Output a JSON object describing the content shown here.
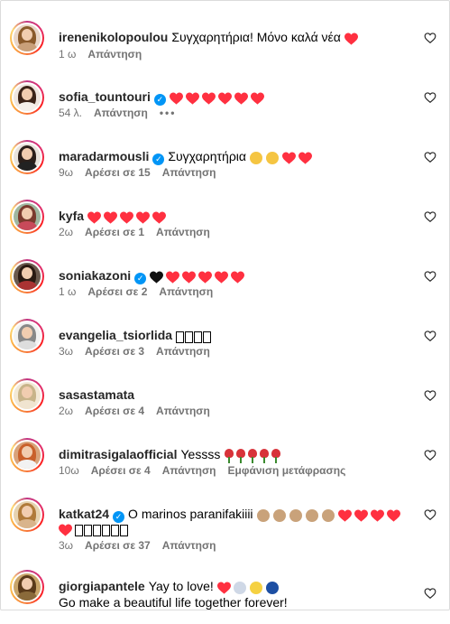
{
  "comments": [
    {
      "username": "irenenikolopoulou",
      "verified": false,
      "text": "Συγχαρητήρια! Μόνο καλά νέα",
      "time": "1 ω",
      "likes": "",
      "reply": "Απάντηση"
    },
    {
      "username": "sofia_tountouri",
      "verified": true,
      "text": "",
      "time": "54 λ.",
      "likes": "",
      "reply": "Απάντηση"
    },
    {
      "username": "maradarmousli",
      "verified": true,
      "text": "Συγχαρητήρια",
      "time": "9ω",
      "likes": "Αρέσει σε 15",
      "reply": "Απάντηση"
    },
    {
      "username": "kyfa",
      "verified": false,
      "text": "",
      "time": "2ω",
      "likes": "Αρέσει σε 1",
      "reply": "Απάντηση"
    },
    {
      "username": "soniakazoni",
      "verified": true,
      "text": "",
      "time": "1 ω",
      "likes": "Αρέσει σε 2",
      "reply": "Απάντηση"
    },
    {
      "username": "evangelia_tsiorlida",
      "verified": false,
      "text": "",
      "time": "3ω",
      "likes": "Αρέσει σε 3",
      "reply": "Απάντηση"
    },
    {
      "username": "sasastamata",
      "verified": false,
      "text": "",
      "time": "2ω",
      "likes": "Αρέσει σε 4",
      "reply": "Απάντηση"
    },
    {
      "username": "dimitrasigalaofficial",
      "verified": false,
      "text": "Yessss",
      "time": "10ω",
      "likes": "Αρέσει σε 4",
      "reply": "Απάντηση",
      "translate": "Εμφάνιση μετάφρασης"
    },
    {
      "username": "katkat24",
      "verified": true,
      "text": "Ο marinos paranifakiiii",
      "time": "3ω",
      "likes": "Αρέσει σε 37",
      "reply": "Απάντηση"
    },
    {
      "username": "giorgiapantele",
      "verified": false,
      "text": "Yay to love!",
      "text2": "Go make a beautiful life together forever!",
      "time": "",
      "likes": "",
      "reply": ""
    }
  ],
  "colors": {
    "heart": "#ff3040",
    "verified": "#0095f6",
    "meta": "#737373",
    "ring_start": "#c13584",
    "ring_end": "#feda75"
  },
  "icons": {
    "like": "heart-outline-icon",
    "more": "more-options-icon",
    "verified": "verified-badge-icon"
  }
}
